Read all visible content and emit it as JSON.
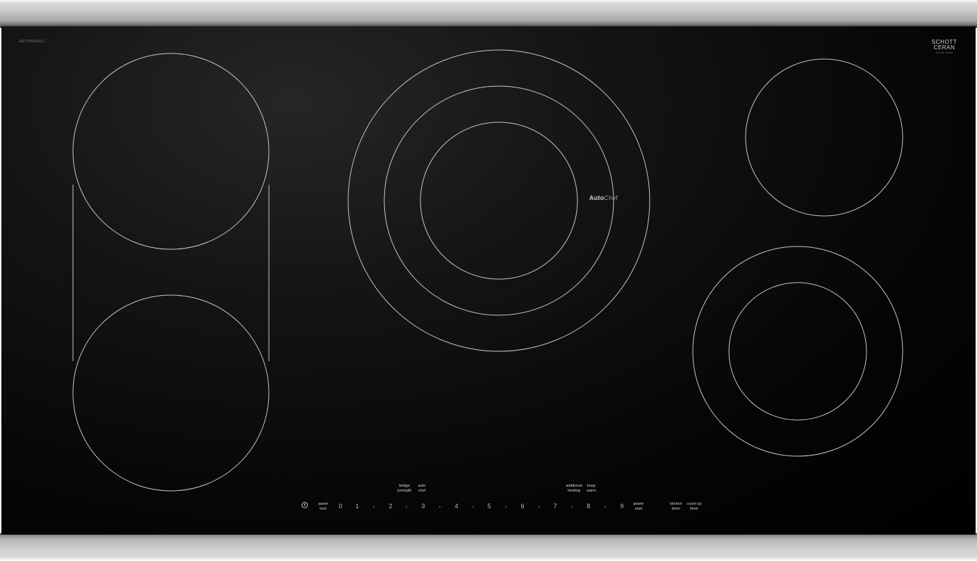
{
  "cooktop": {
    "model_number": "NETP668SUC",
    "brand": {
      "line1": "SCHOTT",
      "line2": "CERAN",
      "sub": "Schott Ceran"
    },
    "autochef": {
      "auto": "Auto",
      "chef": "Chef"
    },
    "controls": {
      "power_icon": "power-icon",
      "panel_lock": [
        "panel",
        "lock"
      ],
      "scale": [
        "0",
        "1",
        "2",
        "3",
        "4",
        "5",
        "6",
        "7",
        "8",
        "9"
      ],
      "power_start": [
        "power",
        "start"
      ],
      "bridge": [
        "bridge",
        "join/split"
      ],
      "auto_chef": [
        "auto",
        "chef"
      ],
      "additional_heating": [
        "additional",
        "heating"
      ],
      "keep_warm": [
        "keep",
        "warm"
      ],
      "kitchen_timer": [
        "kitchen",
        "timer"
      ],
      "count_up_timer": [
        "count up",
        "timer"
      ]
    }
  }
}
